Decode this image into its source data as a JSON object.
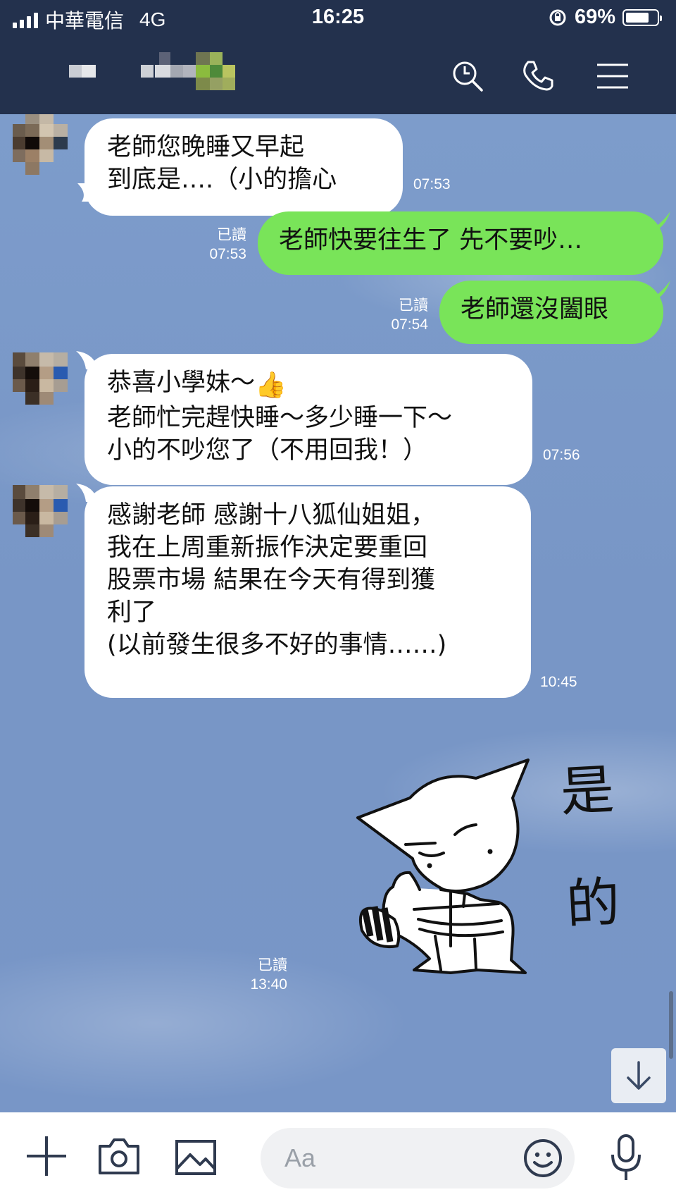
{
  "status_bar": {
    "carrier": "中華電信",
    "network": "4G",
    "time": "16:25",
    "battery_percent": "69%",
    "battery_level": 0.69
  },
  "header": {
    "icons": [
      "search-icon",
      "phone-icon",
      "menu-icon"
    ]
  },
  "messages": [
    {
      "direction": "in",
      "text": "老師您晚睡又早起\n到底是….（小的擔心",
      "time": "07:53"
    },
    {
      "direction": "out",
      "text": "老師快要往生了 先不要吵…",
      "read": "已讀",
      "time": "07:53"
    },
    {
      "direction": "out",
      "text": "老師還沒闔眼",
      "read": "已讀",
      "time": "07:54"
    },
    {
      "direction": "in",
      "text_line1": "恭喜小學妹～",
      "emoji": "👍",
      "text_rest": "老師忙完趕快睡～多少睡一下～\n小的不吵您了（不用回我！）",
      "time": "07:56"
    },
    {
      "direction": "in",
      "text": "感謝老師 感謝十八狐仙姐姐，\n我在上周重新振作決定要重回\n股票市場 結果在今天有得到獲\n利了\n(以前發生很多不好的事情……)",
      "time": "10:45"
    },
    {
      "direction": "out",
      "type": "sticker",
      "sticker_text": "是的",
      "read": "已讀",
      "time": "13:40"
    }
  ],
  "input_bar": {
    "placeholder": "Aa",
    "icons": [
      "plus-icon",
      "camera-icon",
      "image-icon",
      "emoji-icon",
      "microphone-icon"
    ]
  },
  "colors": {
    "header_bg": "#23314d",
    "chat_bg": "#7b9bcb",
    "outgoing_bubble": "#79e459",
    "incoming_bubble": "#ffffff"
  }
}
